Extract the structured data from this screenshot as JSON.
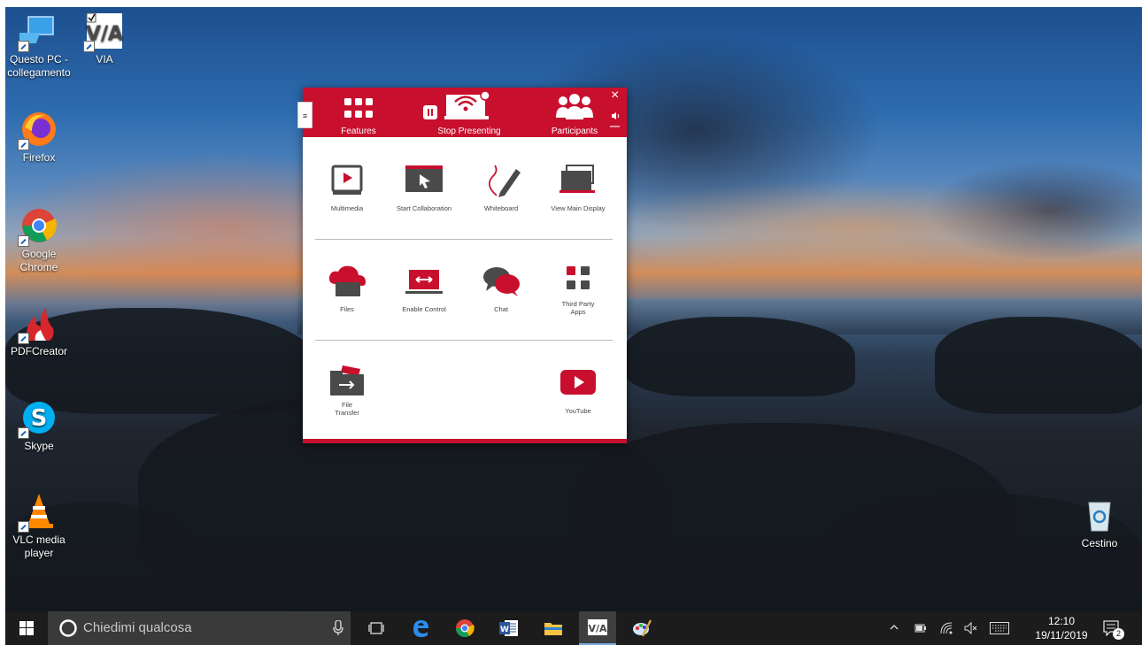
{
  "desktop": {
    "icons": [
      {
        "label": "Questo PC -\ncollegamento",
        "icon": "computer-icon"
      },
      {
        "label": "VIA",
        "icon": "via-app-icon"
      },
      {
        "label": "Firefox",
        "icon": "firefox-icon"
      },
      {
        "label": "Google\nChrome",
        "icon": "chrome-icon"
      },
      {
        "label": "PDFCreator",
        "icon": "pdfcreator-icon"
      },
      {
        "label": "Skype",
        "icon": "skype-icon"
      },
      {
        "label": "VLC media\nplayer",
        "icon": "vlc-icon"
      },
      {
        "label": "Cestino",
        "icon": "recycle-bin-icon"
      }
    ]
  },
  "via": {
    "tab_logo": "≡",
    "header": {
      "features": "Features",
      "stop_presenting": "Stop Presenting",
      "participants": "Participants",
      "close": "×",
      "minimize": "—"
    },
    "features": [
      {
        "label": "Multimedia",
        "icon": "multimedia-icon"
      },
      {
        "label": "Start Collaboration",
        "icon": "start-collaboration-icon"
      },
      {
        "label": "Whiteboard",
        "icon": "whiteboard-icon"
      },
      {
        "label": "View Main Display",
        "icon": "view-main-display-icon"
      },
      {
        "label": "Files",
        "icon": "files-cloud-icon"
      },
      {
        "label": "Enable Control",
        "icon": "enable-control-icon"
      },
      {
        "label": "Chat",
        "icon": "chat-icon"
      },
      {
        "label": "Third Party\nApps",
        "icon": "third-party-apps-icon"
      },
      {
        "label": "File\nTransfer",
        "icon": "file-transfer-icon"
      },
      {
        "label": "YouTube",
        "icon": "youtube-icon"
      }
    ],
    "accent": "#c8102e"
  },
  "taskbar": {
    "search_placeholder": "Chiedimi qualcosa",
    "time": "12:10",
    "date": "19/11/2019",
    "notification_count": "2",
    "apps": [
      "edge-icon",
      "chrome-icon",
      "word-icon",
      "file-explorer-icon",
      "via-app-icon",
      "paint-icon"
    ]
  }
}
